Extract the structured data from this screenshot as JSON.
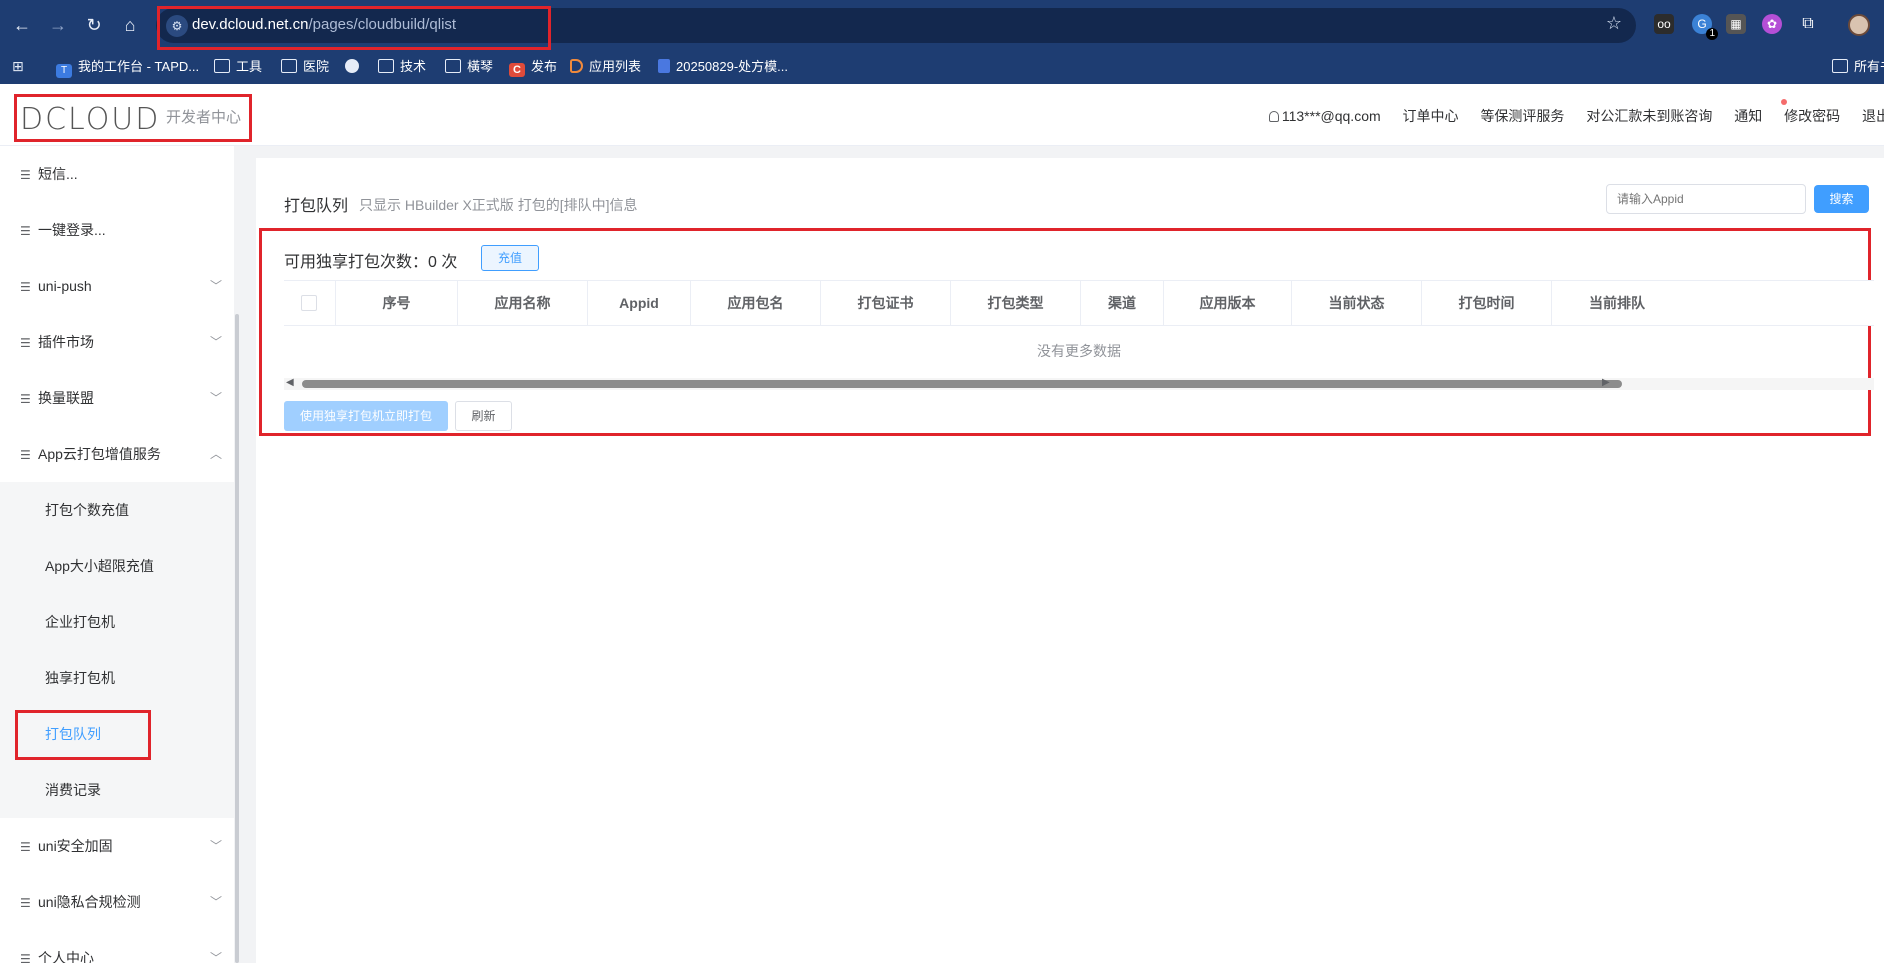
{
  "browser": {
    "url_host": "dev.dcloud.net.cn",
    "url_path": "/pages/cloudbuild/qlist",
    "ext_badge": "1",
    "bookmarks": [
      {
        "label": "我的工作台 - TAPD...",
        "icon": "tapd-icon"
      },
      {
        "label": "工具",
        "icon": "folder-icon"
      },
      {
        "label": "医院",
        "icon": "folder-icon"
      },
      {
        "label": "",
        "icon": "globe-icon"
      },
      {
        "label": "技术",
        "icon": "folder-icon"
      },
      {
        "label": "橫琴",
        "icon": "folder-icon"
      },
      {
        "label": "发布",
        "icon": "c-app-icon"
      },
      {
        "label": "应用列表",
        "icon": "dcloud-icon"
      },
      {
        "label": "20250829-处方模...",
        "icon": "doc-icon"
      },
      {
        "label": "所有书",
        "icon": "folder-icon"
      }
    ]
  },
  "header": {
    "logo_text": "DCLOUD",
    "logo_sub": "开发者中心",
    "user": "113***@qq.com",
    "nav": [
      "订单中心",
      "等保测评服务",
      "对公汇款未到账咨询",
      "通知",
      "修改密码",
      "退出"
    ]
  },
  "sidebar": {
    "items": [
      {
        "label": "短信...",
        "chevron": false
      },
      {
        "label": "一键登录...",
        "chevron": false
      },
      {
        "label": "uni-push",
        "chevron": true
      },
      {
        "label": "插件市场",
        "chevron": true
      },
      {
        "label": "换量联盟",
        "chevron": true
      },
      {
        "label": "App云打包增值服务",
        "chevron": true
      }
    ],
    "sub_items": [
      "打包个数充值",
      "App大小超限充值",
      "企业打包机",
      "独享打包机",
      "打包队列",
      "消费记录"
    ],
    "bottom_items": [
      "uni安全加固",
      "uni隐私合规检测",
      "个人中心"
    ]
  },
  "main": {
    "title": "打包队列",
    "description": "只显示 HBuilder X正式版 打包的[排队中]信息",
    "search_placeholder": "请输入Appid",
    "search_label": "搜索",
    "quota_label": "可用独享打包次数：0 次",
    "recharge_label": "充值",
    "columns": [
      "序号",
      "应用名称",
      "Appid",
      "应用包名",
      "打包证书",
      "打包类型",
      "渠道",
      "应用版本",
      "当前状态",
      "打包时间",
      "当前排队"
    ],
    "empty_text": "没有更多数据",
    "exclusive_button": "使用独享打包机立即打包",
    "refresh_button": "刷新"
  },
  "colors": {
    "chrome": "#1e3d72",
    "accent": "#409eff",
    "annotation": "#e0242b",
    "active_menu": "#409eff"
  }
}
